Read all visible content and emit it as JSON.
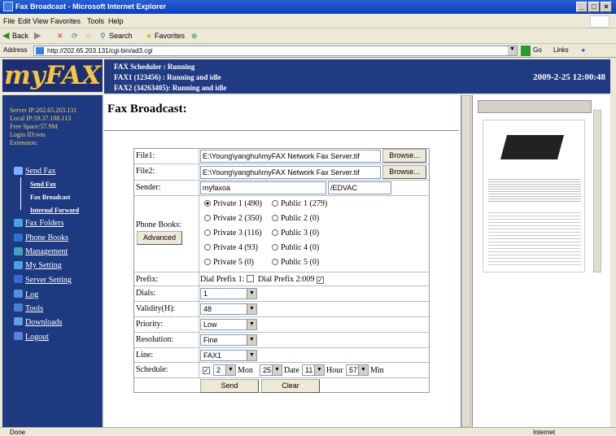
{
  "window": {
    "title": "Fax Broadcast - Microsoft Internet Explorer"
  },
  "menu": [
    "File",
    "Edit",
    "View",
    "Favorites",
    "Tools",
    "Help"
  ],
  "toolbar": {
    "back": "Back",
    "search": "Search",
    "favorites": "Favorites"
  },
  "address": {
    "label": "Address",
    "url": "http://202.65.203.131/cgi-bin/ad3.cgi",
    "go": "Go",
    "links": "Links"
  },
  "header": {
    "logo": "myFAX",
    "status_lines": [
      "FAX Scheduler : Running",
      "FAX1 (123456) : Running and idle",
      "FAX2 (34263405): Running and idle"
    ],
    "clock": "2009-2-25 12:00:48"
  },
  "sidebar": {
    "info": [
      "Server IP:202.65.203.131",
      "Local IP:59.37.188.113",
      "Free Space:57.9M",
      "Login ID:wm",
      "Extension:"
    ],
    "nav": [
      {
        "label": "Send Fax",
        "color": "#6aa0ff"
      },
      {
        "label": "Fax Folders",
        "color": "#4aa0e0"
      },
      {
        "label": "Phone Books",
        "color": "#3070d0"
      },
      {
        "label": "Management",
        "color": "#40a0c0"
      },
      {
        "label": "My Setting",
        "color": "#50a0e0"
      },
      {
        "label": "Server Setting",
        "color": "#3a6ad0"
      },
      {
        "label": "Log",
        "color": "#5090e0"
      },
      {
        "label": "Tools",
        "color": "#4a80d0"
      },
      {
        "label": "Downloads",
        "color": "#60a0e0"
      },
      {
        "label": "Logout",
        "color": "#6080e0"
      }
    ],
    "sub": [
      "Send Fax",
      "Fax Broadcast",
      "Internal Forward"
    ]
  },
  "main": {
    "title": "Fax Broadcast:",
    "file1": {
      "label": "File1:",
      "value": "E:\\Young\\yanghui\\myFAX Network Fax Server.tif",
      "browse": "Browse..."
    },
    "file2": {
      "label": "File2:",
      "value": "E:\\Young\\yanghui\\myFAX Network Fax Server.tif",
      "browse": "Browse..."
    },
    "sender": {
      "label": "Sender:",
      "name": "myfaxoa",
      "company": "/EDVAC"
    },
    "phonebooks": {
      "label": "Phone Books:",
      "advanced": "Advanced",
      "options": [
        [
          "Private 1 (490)",
          "Public 1 (279)"
        ],
        [
          "Private 2 (350)",
          "Public 2 (0)"
        ],
        [
          "Private 3 (116)",
          "Public 3 (0)"
        ],
        [
          "Private 4 (93)",
          "Public 4 (0)"
        ],
        [
          "Private 5 (0)",
          "Public 5 (0)"
        ]
      ]
    },
    "prefix": {
      "label": "Prefix:",
      "text1": "Dial Prefix 1:",
      "text2": "Dial Prefix 2:009",
      "check": "✓"
    },
    "dials": {
      "label": "Dials:",
      "value": "1"
    },
    "validity": {
      "label": "Validity(H):",
      "value": "48"
    },
    "priority": {
      "label": "Priority:",
      "value": "Low"
    },
    "resolution": {
      "label": "Resolution:",
      "value": "Fine"
    },
    "line": {
      "label": "Line:",
      "value": "FAX1"
    },
    "schedule": {
      "label": "Schedule:",
      "check": "✓",
      "mon": "2",
      "mon_label": "Mon",
      "date": "25",
      "date_label": "Date",
      "hour": "11",
      "hour_label": "Hour",
      "min": "57",
      "min_label": "Min"
    },
    "send": "Send",
    "clear": "Clear"
  },
  "status": {
    "left": "Done",
    "right": "Internet"
  }
}
